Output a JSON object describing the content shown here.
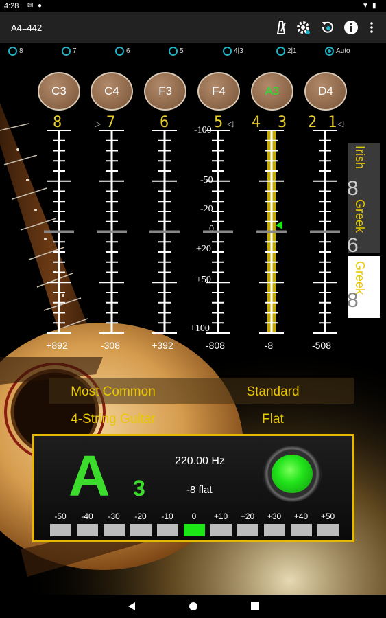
{
  "status": {
    "time": "4:28"
  },
  "app_bar": {
    "title": "A4=442",
    "icons": [
      "metronome-icon",
      "settings-icon",
      "undo-icon",
      "info-icon",
      "more-vert-icon"
    ]
  },
  "string_select": {
    "options": [
      {
        "label": "8",
        "selected": false
      },
      {
        "label": "7",
        "selected": false
      },
      {
        "label": "6",
        "selected": false
      },
      {
        "label": "5",
        "selected": false
      },
      {
        "label": "4|3",
        "selected": false
      },
      {
        "label": "2|1",
        "selected": false
      },
      {
        "label": "Auto",
        "selected": true
      }
    ]
  },
  "notes": [
    {
      "label": "C3",
      "active": false
    },
    {
      "label": "C4",
      "active": false
    },
    {
      "label": "F3",
      "active": false
    },
    {
      "label": "F4",
      "active": false
    },
    {
      "label": "A3",
      "active": true
    },
    {
      "label": "D4",
      "active": false
    }
  ],
  "string_numbers": [
    "8",
    "7",
    "6",
    "5",
    "4",
    "3",
    "2",
    "1"
  ],
  "cents_scale": [
    "-100",
    "-50",
    "-20",
    "0",
    "+20",
    "+50",
    "+100"
  ],
  "deviation_labels": [
    "+892",
    "-308",
    "+392",
    "-808",
    "-8",
    "-508"
  ],
  "tuning_options": [
    "Irish",
    "Greek",
    "Greek"
  ],
  "tuning_numbers": [
    "8",
    "6",
    "8"
  ],
  "info": {
    "row1_left": "Most Common",
    "row1_right": "Standard",
    "row2_left": "4-String Guitar",
    "row2_right": "Flat"
  },
  "tuner": {
    "note": "A",
    "octave": "3",
    "frequency": "220.00 Hz",
    "cents_text": "-8 flat",
    "in_tune_color": "#21e41a",
    "scale_labels": [
      "-50",
      "-40",
      "-30",
      "-20",
      "-10",
      "0",
      "+10",
      "+20",
      "+30",
      "+40",
      "+50"
    ],
    "active_index": 5
  },
  "colors": {
    "accent_yellow": "#e8c800",
    "note_green": "#3cdc2c",
    "radio_teal": "#1fb1c4"
  }
}
